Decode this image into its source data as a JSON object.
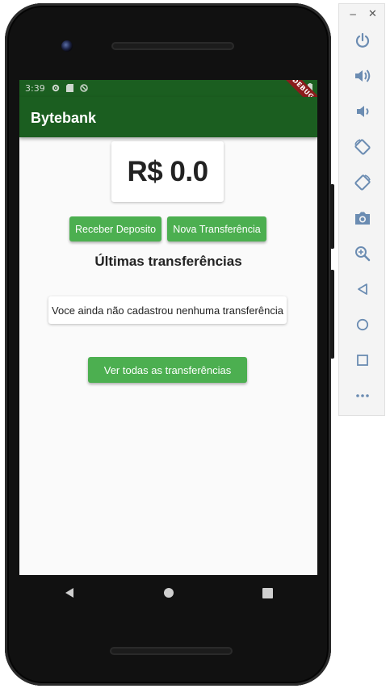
{
  "status_bar": {
    "time": "3:39"
  },
  "debug_banner": "DEBUG",
  "app_bar": {
    "title": "Bytebank"
  },
  "balance": {
    "text": "R$ 0.0"
  },
  "actions": {
    "deposit_label": "Receber Deposito",
    "transfer_label": "Nova Transferência"
  },
  "recent": {
    "title": "Últimas transferências",
    "empty_message": "Voce ainda não cadastrou nenhuma transferência",
    "view_all_label": "Ver todas as transferências"
  },
  "nav_bar": {
    "icons": [
      "back-icon",
      "home-icon",
      "recents-icon"
    ]
  },
  "emulator_toolbar": {
    "window_controls": [
      "minimize-icon",
      "close-icon"
    ],
    "icons": [
      "power-icon",
      "volume-up-icon",
      "volume-down-icon",
      "rotate-left-icon",
      "rotate-right-icon",
      "camera-icon",
      "zoom-icon",
      "back-icon",
      "home-icon",
      "overview-icon",
      "more-icon"
    ]
  },
  "colors": {
    "app_bar": "#1b5e20",
    "button": "#4caf50",
    "background": "#fafafa",
    "debug_banner": "#8a1c1c",
    "toolbar_icon": "#6b8cb2"
  }
}
